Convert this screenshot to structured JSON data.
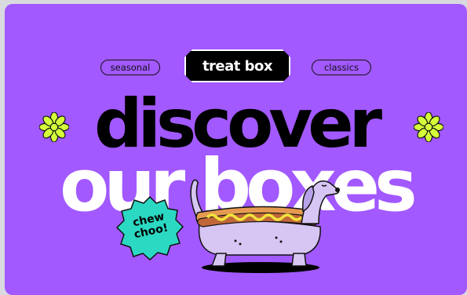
{
  "pills": {
    "left": "seasonal",
    "right": "classics"
  },
  "brand": "treat box",
  "headline": {
    "line1": "discover",
    "line2": "our boxes"
  },
  "badge": {
    "line1": "chew",
    "line2": "choo!"
  },
  "colors": {
    "background": "#a259ff",
    "accent": "#d4ff3a",
    "badge": "#2bd9c3"
  },
  "icons": [
    "sparkle-icon",
    "hotdog-dog-illustration"
  ]
}
